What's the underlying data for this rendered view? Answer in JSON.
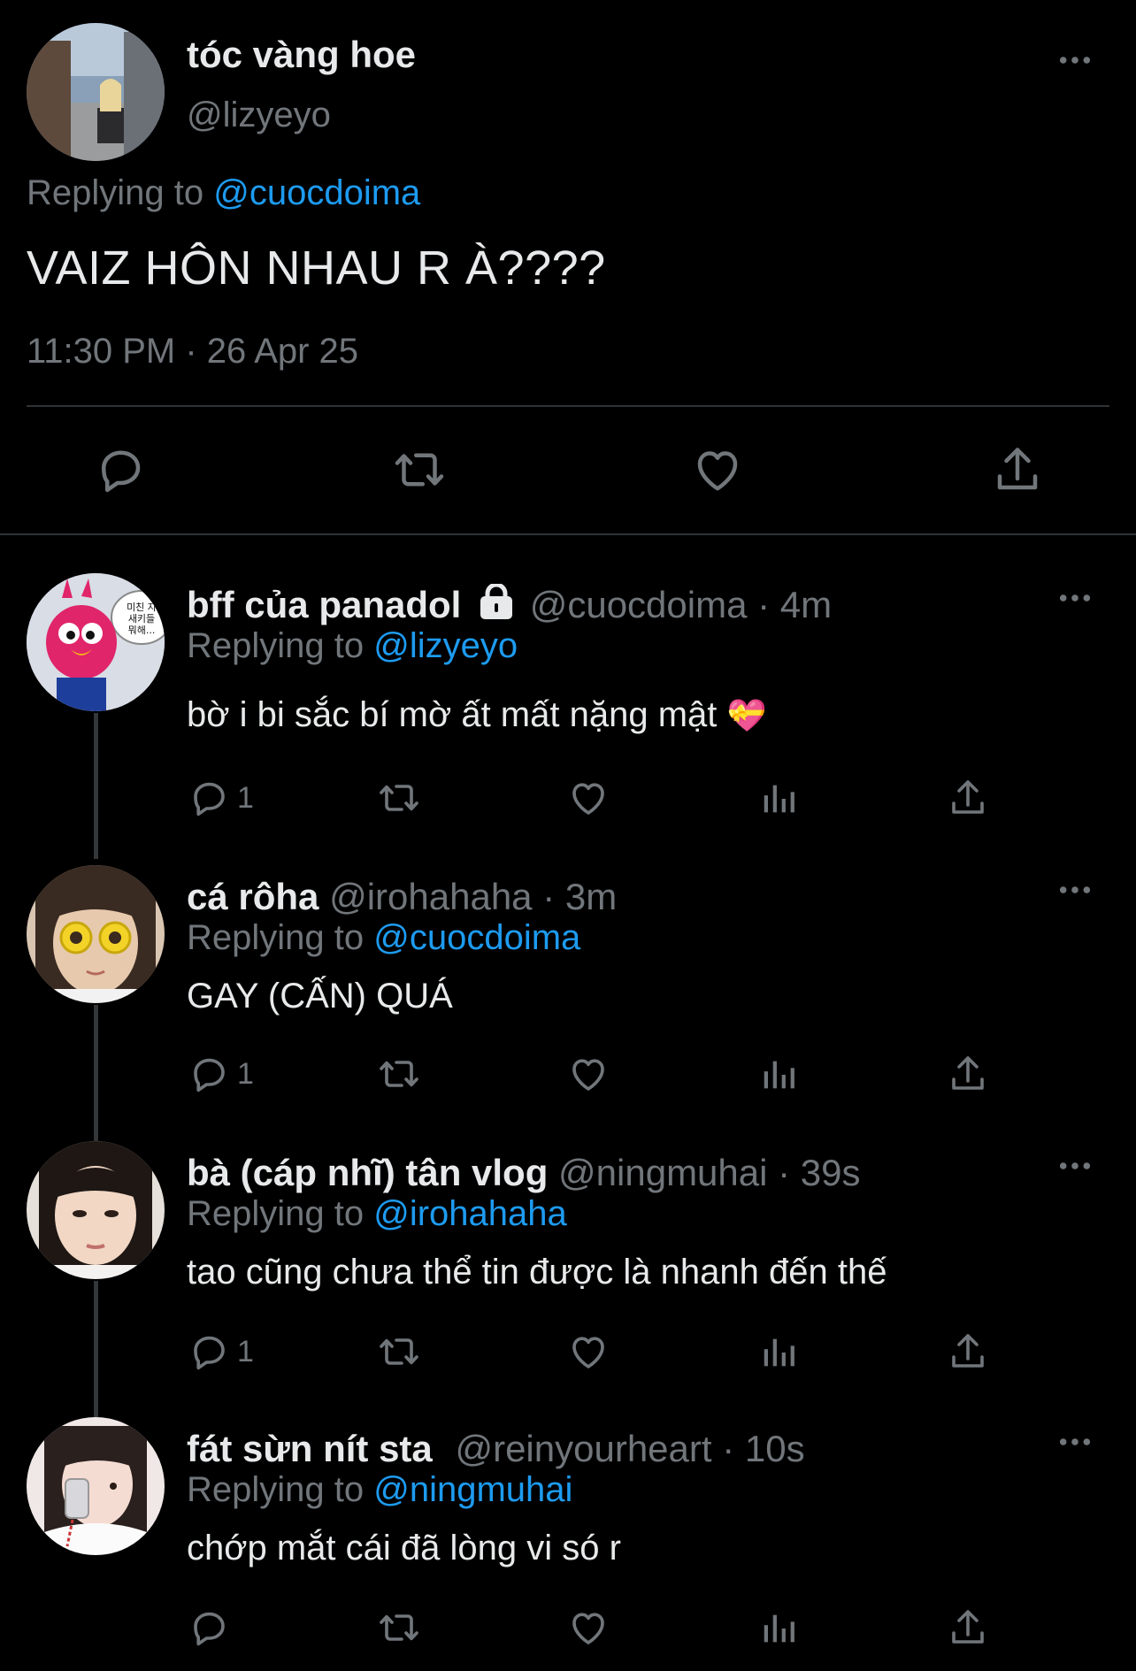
{
  "main_tweet": {
    "display_name": "tóc vàng hoe",
    "handle": "@lizyeyo",
    "replying_prefix": "Replying to ",
    "replying_to": "@cuocdoima",
    "text": "VAIZ HÔN NHAU R À????",
    "timestamp": "11:30 PM · 26 Apr 25",
    "actions": [
      "reply-icon",
      "retweet-icon",
      "like-icon",
      "share-icon"
    ]
  },
  "replies": [
    {
      "display_name": "bff của panadol",
      "locked": true,
      "handle": "@cuocdoima",
      "time": "· 4m",
      "replying_prefix": "Replying to ",
      "replying_to": "@lizyeyo",
      "text": "bờ i bi sắc bí mờ ất mất nặng mật",
      "emoji": "💝",
      "reply_count": "1",
      "avatar_text": "미친 자 새키들 뭐해..."
    },
    {
      "display_name": "cá rôha",
      "handle": "@irohahaha",
      "time": "· 3m",
      "replying_prefix": "Replying to ",
      "replying_to": "@cuocdoima",
      "text": "GAY (CẤN) QUÁ",
      "reply_count": "1"
    },
    {
      "display_name": "bà (cáp nhĩ) tân vlog",
      "handle": "@ningmuhai",
      "time": "· 39s",
      "replying_prefix": "Replying to ",
      "replying_to": "@irohahaha",
      "text": "tao cũng chưa thể tin được là nhanh đến thế",
      "reply_count": "1"
    },
    {
      "display_name": "fát sừn nít sta",
      "handle": "@reinyourheart",
      "time": "· 10s",
      "replying_prefix": "Replying to ",
      "replying_to": "@ningmuhai",
      "text": "chớp mắt cái đã lòng vi só r",
      "reply_count": ""
    }
  ],
  "colors": {
    "background": "#000000",
    "text": "#e7e9ea",
    "muted": "#71767b",
    "link": "#1d9bf0",
    "divider": "#2f3336"
  }
}
